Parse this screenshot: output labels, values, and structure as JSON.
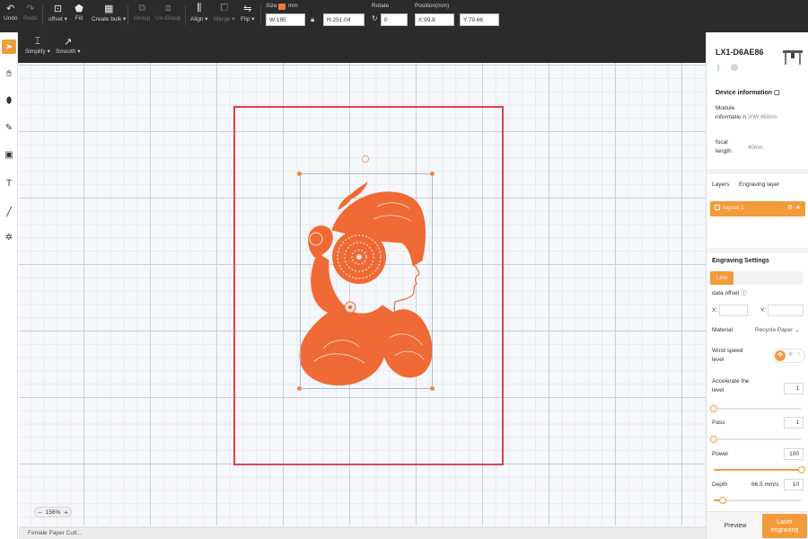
{
  "toolbar": {
    "undo": "Undo",
    "redo": "Redo",
    "offset": "offset",
    "fill": "Fill",
    "create_bulk": "Create bulk",
    "group": "Group",
    "ungroup": "Un-Group",
    "align": "Align",
    "merge": "Merge",
    "flip": "Flip"
  },
  "props": {
    "size_label": "Size",
    "unit": "mm",
    "width": "W:195",
    "height": "H:251.04",
    "rotate_label": "Rotate",
    "rotate_value": "0",
    "position_label": "Position(mm)",
    "pos_x": "X:99.8",
    "pos_y": "Y:79.66"
  },
  "subtoolbar": {
    "simplify": "Simplify",
    "smooth": "Smooth"
  },
  "canvas": {
    "zoom": "156%",
    "art_color": "#f06a35"
  },
  "file": {
    "tab": "Female Paper Cutt..."
  },
  "panel": {
    "device_name": "LX1-D6AE86",
    "device_info_title": "Device information",
    "module_label": "Module informatio n",
    "module_value": "20W 450nm",
    "focal_label": "focal length",
    "focal_value": "40mm",
    "tab_layers": "Layers",
    "tab_engraving_layer": "Engraving layer",
    "layer_name": "layout 1",
    "engraving_settings": "Engraving Settings",
    "mode_line": "Line",
    "data_offset": "data offset",
    "x_label": "X:",
    "y_label": "Y:",
    "material_label": "Material",
    "material_value": "Recycle Paper",
    "wind_speed_label": "Wind speed level",
    "accelerate_label": "Accelerate the level",
    "accelerate_value": "1",
    "pass_label": "Pass",
    "pass_value": "1",
    "power_label": "Power",
    "power_value": "100",
    "power_level": 1.0,
    "accelerate_level": 0.0,
    "pass_level": 0.0,
    "depth_label": "Depth",
    "depth_speed": "66.5 mm/s",
    "depth_value": "10",
    "depth_level": 0.1,
    "preview": "Preview",
    "laser_engraving": "Laser engraving"
  },
  "colors": {
    "accent": "#f39a3a",
    "toolbar_bg": "#2b2b2b",
    "work_area_border": "#e0404e"
  }
}
